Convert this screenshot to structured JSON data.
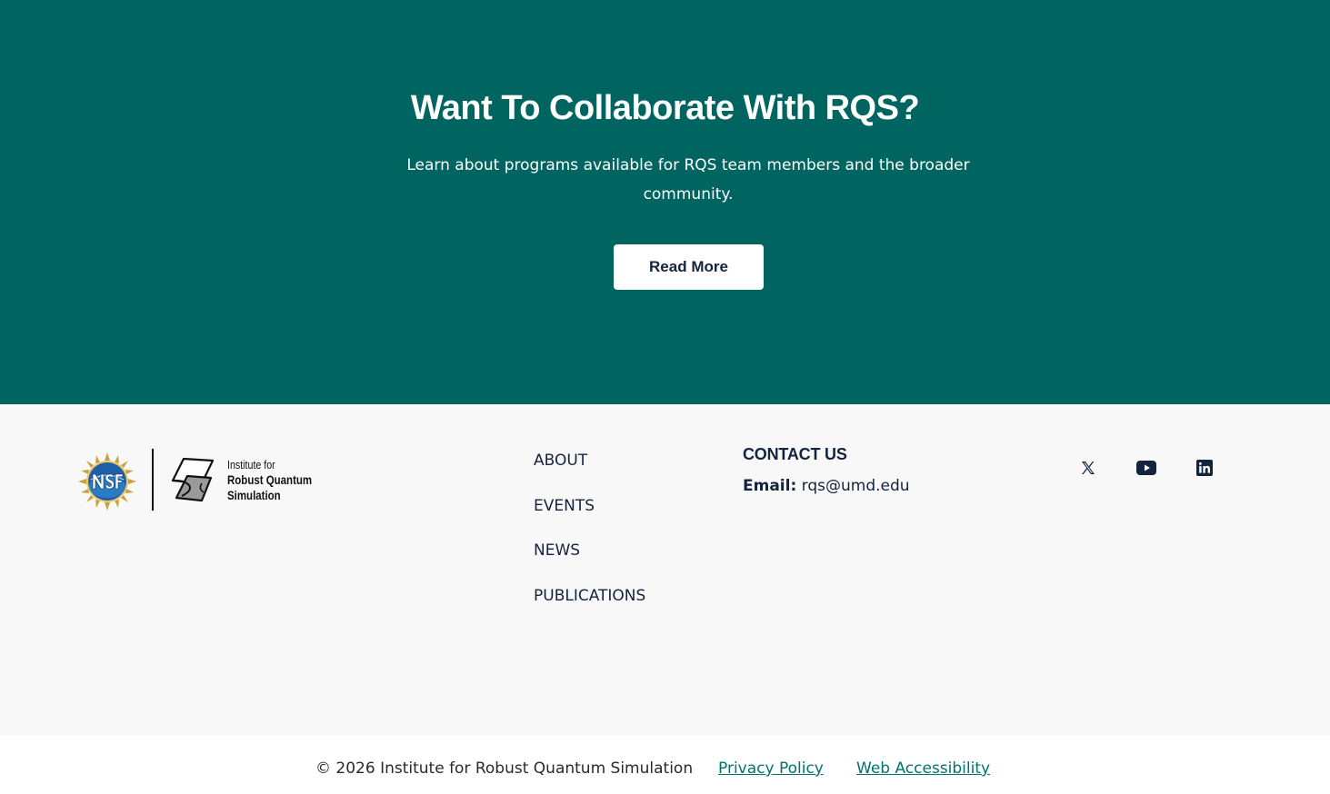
{
  "cta": {
    "title": "Want To Collaborate With RQS?",
    "text": "Learn about programs available for RQS team members and the broader community.",
    "button_label": "Read More"
  },
  "footer": {
    "logo_text": [
      "Institute for",
      "Robust Quantum",
      "Simulation"
    ],
    "nav": [
      {
        "label": "ABOUT"
      },
      {
        "label": "EVENTS"
      },
      {
        "label": "NEWS"
      },
      {
        "label": "PUBLICATIONS"
      }
    ],
    "contact": {
      "heading": "CONTACT US",
      "email_label": "Email:",
      "email": "rqs@umd.edu"
    },
    "social_icons": [
      "x-twitter-icon",
      "youtube-icon",
      "linkedin-icon"
    ]
  },
  "bottom": {
    "copyright": "© 2026 Institute for Robust Quantum Simulation",
    "privacy": "Privacy Policy",
    "accessibility": "Web Accessibility"
  },
  "colors": {
    "cta_bg": "#006461",
    "footer_bg": "#f8f8f8",
    "text_navy": "#14243f",
    "link_teal": "#00736e"
  }
}
